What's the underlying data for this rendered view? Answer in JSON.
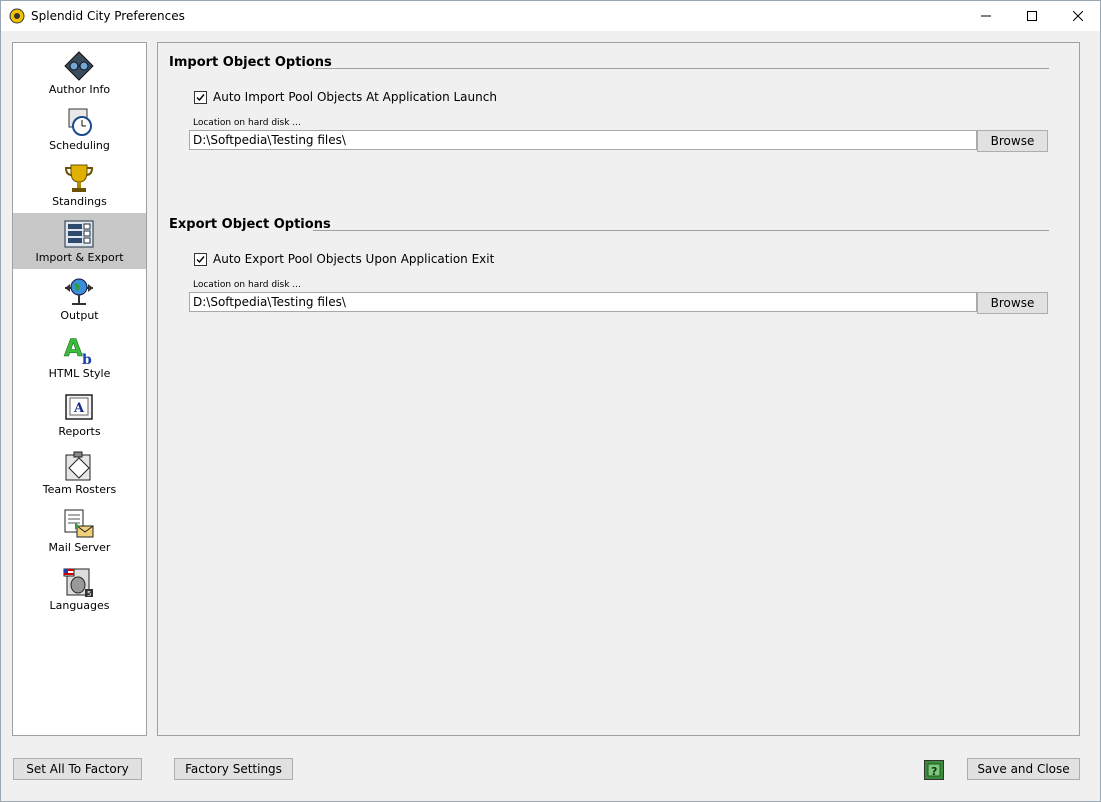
{
  "window": {
    "title": "Splendid City Preferences"
  },
  "sidebar": {
    "items": [
      {
        "label": "Author Info",
        "icon": "author-info-icon"
      },
      {
        "label": "Scheduling",
        "icon": "clock-icon"
      },
      {
        "label": "Standings",
        "icon": "trophy-icon"
      },
      {
        "label": "Import & Export",
        "icon": "import-export-icon",
        "active": true
      },
      {
        "label": "Output",
        "icon": "globe-icon"
      },
      {
        "label": "HTML Style",
        "icon": "text-style-icon"
      },
      {
        "label": "Reports",
        "icon": "report-icon"
      },
      {
        "label": "Team Rosters",
        "icon": "clipboard-icon"
      },
      {
        "label": "Mail Server",
        "icon": "mail-server-icon"
      },
      {
        "label": "Languages",
        "icon": "languages-icon"
      }
    ]
  },
  "import": {
    "title": "Import Object Options",
    "checkbox_label": "Auto Import Pool Objects At Application Launch",
    "checked": true,
    "location_label": "Location on hard disk ...",
    "path": "D:\\Softpedia\\Testing files\\",
    "browse": "Browse"
  },
  "export": {
    "title": "Export Object Options",
    "checkbox_label": "Auto Export Pool Objects Upon Application Exit",
    "checked": true,
    "location_label": "Location on hard disk ...",
    "path": "D:\\Softpedia\\Testing files\\",
    "browse": "Browse"
  },
  "footer": {
    "set_all_factory": "Set All To Factory",
    "factory_settings": "Factory Settings",
    "save_close": "Save and Close"
  },
  "colors": {
    "active_nav": "#c8c8c8",
    "panel_bg": "#f0f0f0",
    "help_green": "#3c8b3c"
  }
}
